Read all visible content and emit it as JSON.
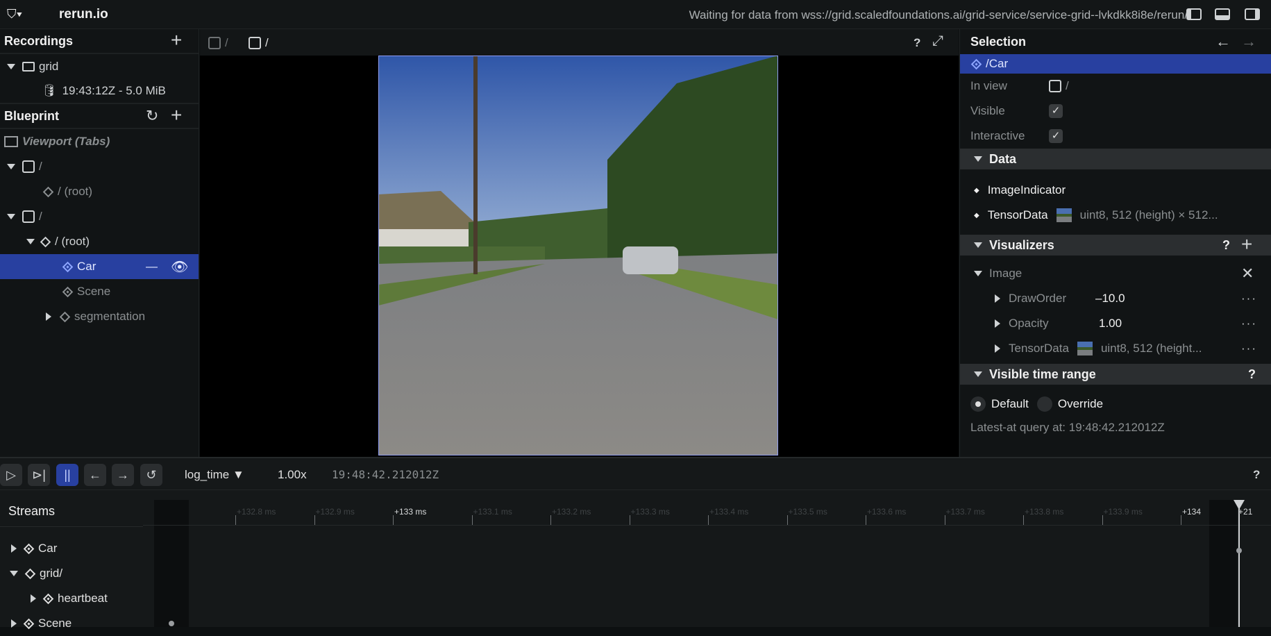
{
  "topbar": {
    "app_title": "rerun.io",
    "status": "Waiting for data from wss://grid.scaledfoundations.ai/grid-service/service-grid--lvkdkk8i8e/rerun/"
  },
  "recordings": {
    "title": "Recordings",
    "items": [
      {
        "label": "grid"
      },
      {
        "label": "19:43:12Z - 5.0 MiB"
      }
    ]
  },
  "blueprint": {
    "title": "Blueprint",
    "viewport": "Viewport (Tabs)",
    "tree": [
      {
        "label": "/"
      },
      {
        "label": "/ (root)"
      },
      {
        "label": "/"
      },
      {
        "label": "/ (root)"
      },
      {
        "label": "Car"
      },
      {
        "label": "Scene"
      },
      {
        "label": "segmentation"
      }
    ]
  },
  "view_tabs": [
    {
      "label": "/"
    },
    {
      "label": "/"
    }
  ],
  "view_help": "?",
  "selection": {
    "title": "Selection",
    "entity": "/Car",
    "in_view_label": "In view",
    "in_view_value": "/",
    "visible_label": "Visible",
    "visible": true,
    "interactive_label": "Interactive",
    "interactive": true,
    "data_section": "Data",
    "data": [
      {
        "name": "ImageIndicator",
        "value": ""
      },
      {
        "name": "TensorData",
        "value": "uint8, 512 (height) × 512..."
      }
    ],
    "visualizers_section": "Visualizers",
    "help": "?",
    "visualizer": "Image",
    "components": [
      {
        "name": "DrawOrder",
        "value": "–10.0"
      },
      {
        "name": "Opacity",
        "value": "1.00"
      },
      {
        "name": "TensorData",
        "value": "uint8, 512 (height..."
      }
    ],
    "time_range_section": "Visible time range",
    "default_label": "Default",
    "override_label": "Override",
    "mode": "Default",
    "latest_at": "Latest-at query at: 19:48:42.212012Z"
  },
  "controls": {
    "timeline": "log_time",
    "speed": "1.00x",
    "time": "19:48:42.212012Z",
    "help": "?",
    "playing": false
  },
  "streams": {
    "title": "Streams",
    "items": [
      {
        "label": "Car"
      },
      {
        "label": "grid/"
      },
      {
        "label": "heartbeat"
      },
      {
        "label": "Scene"
      }
    ]
  },
  "timeline": {
    "ticks": [
      "+132.8 ms",
      "+132.9 ms",
      "+133 ms",
      "+133.1 ms",
      "+133.2 ms",
      "+133.3 ms",
      "+133.4 ms",
      "+133.5 ms",
      "+133.6 ms",
      "+133.7 ms",
      "+133.8 ms",
      "+133.9 ms",
      "+134"
    ],
    "major": [
      "+133 ms",
      "+134"
    ],
    "end_label": "+21"
  },
  "colors": {
    "accent": "#2840a0",
    "background": "#0d1011"
  }
}
